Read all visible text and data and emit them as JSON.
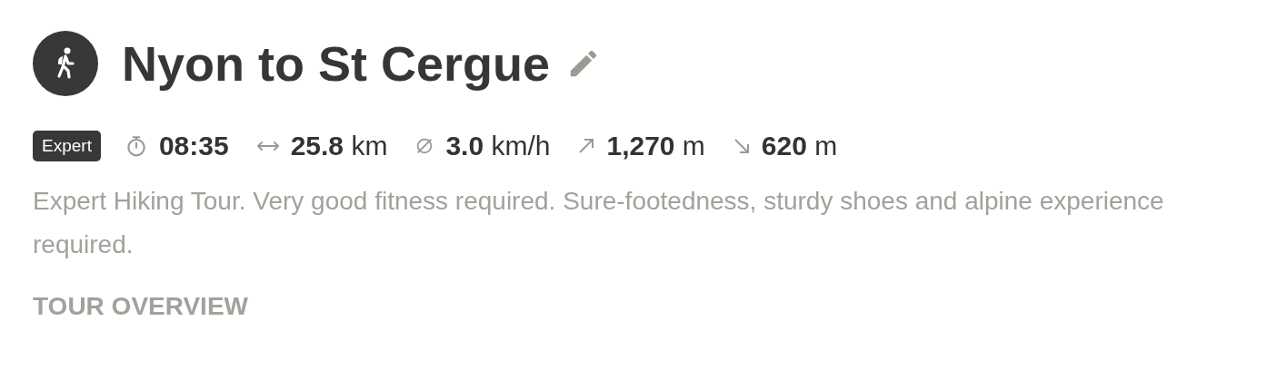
{
  "tour": {
    "title": "Nyon to St Cergue",
    "difficulty": "Expert"
  },
  "stats": [
    {
      "kind": "duration",
      "value": "08:35"
    },
    {
      "kind": "distance",
      "value": "25.8",
      "unit": "km"
    },
    {
      "kind": "speed",
      "value": "3.0",
      "unit": "km/h"
    },
    {
      "kind": "ascent",
      "value": "1,270",
      "unit": "m"
    },
    {
      "kind": "descent",
      "value": "620",
      "unit": "m"
    }
  ],
  "description": "Expert Hiking Tour. Very good fitness required. Sure-footedness, sturdy shoes and alpine experience required.",
  "section_heading": "TOUR OVERVIEW"
}
